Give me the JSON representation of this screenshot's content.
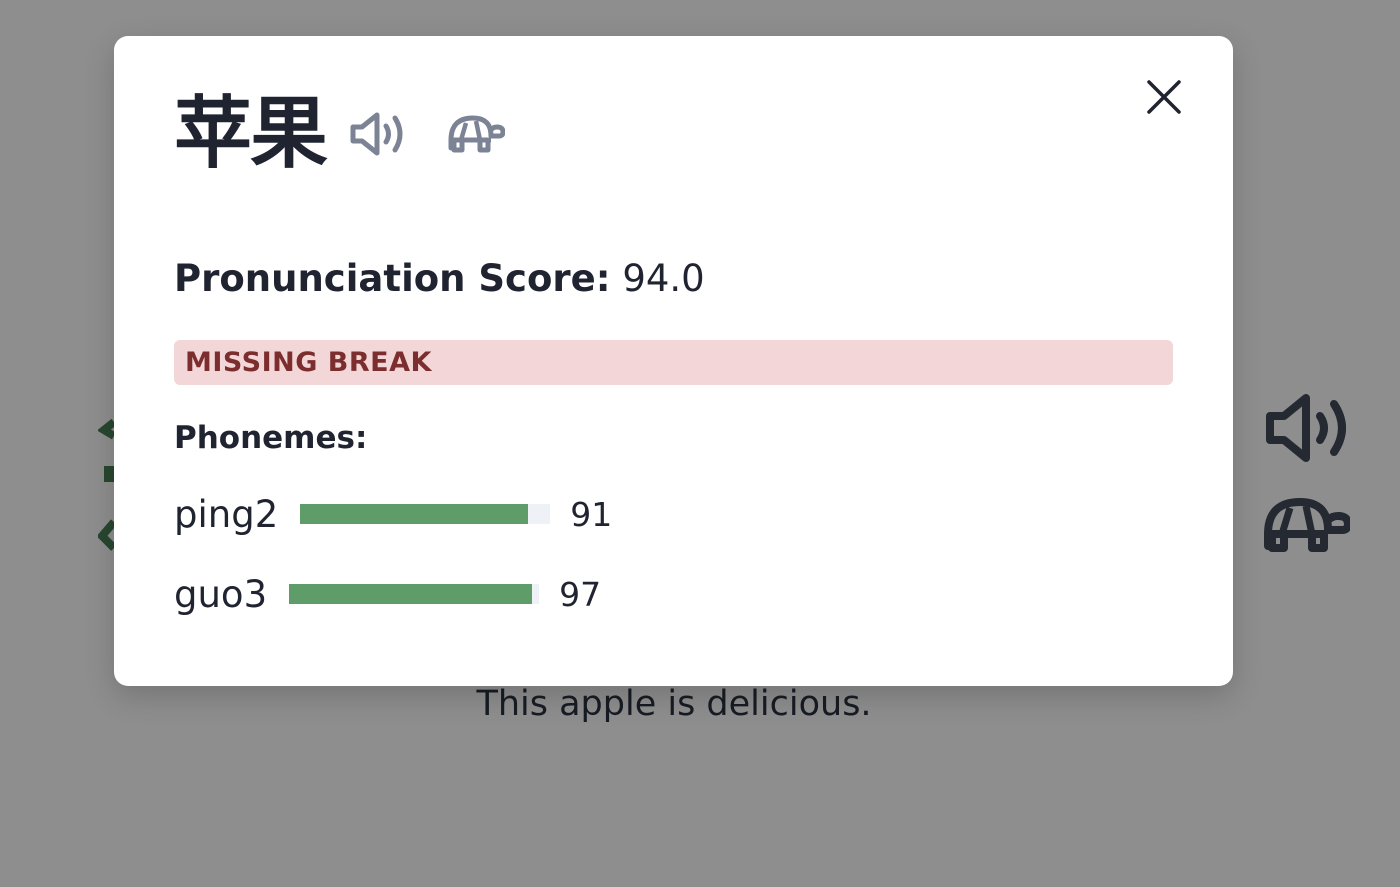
{
  "background": {
    "sentence": "This apple is delicious.",
    "icons": [
      "speaker-icon",
      "turtle-icon"
    ]
  },
  "modal": {
    "title": "苹果",
    "icons": {
      "audio": "speaker-icon",
      "slow_audio": "turtle-icon",
      "close": "close-icon"
    },
    "score_label": "Pronunciation Score:",
    "score_value": "94.0",
    "error_tag": "MISSING BREAK",
    "phonemes_heading": "Phonemes:",
    "phonemes": [
      {
        "label": "ping2",
        "score": "91",
        "fill_fraction": 0.91
      },
      {
        "label": "guo3",
        "score": "97",
        "fill_fraction": 0.97
      }
    ]
  },
  "colors": {
    "overlay": "#878787",
    "bar_fill": "#5e9c6a",
    "bar_track": "#eef1f5",
    "error_bg": "#f3d6d8",
    "error_text": "#7c2d2d",
    "icon_muted": "#7b8395"
  }
}
